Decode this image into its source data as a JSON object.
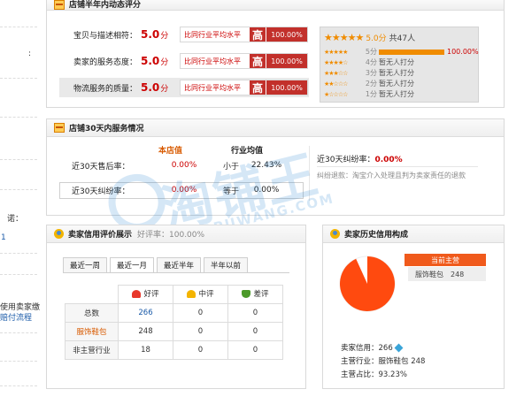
{
  "left_strip": {
    "items": [
      {
        "text": "诺：",
        "color": "#333"
      },
      {
        "text": "使用卖家缴",
        "color": "#333"
      },
      {
        "text": "赔付流程",
        "color": "#1a5aa8"
      }
    ],
    "small_marks": [
      ":",
      "1"
    ]
  },
  "dynamic_rating": {
    "title": "店铺半年内动态评分",
    "rows": [
      {
        "label": "宝贝与描述相符：",
        "score": "5.0",
        "unit": "分",
        "compare_text": "比同行业平均水平",
        "level": "高",
        "percent": "100.00%"
      },
      {
        "label": "卖家的服务态度：",
        "score": "5.0",
        "unit": "分",
        "compare_text": "比同行业平均水平",
        "level": "高",
        "percent": "100.00%"
      },
      {
        "label": "物流服务的质量：",
        "score": "5.0",
        "unit": "分",
        "compare_text": "比同行业平均水平",
        "level": "高",
        "percent": "100.00%"
      }
    ],
    "star_summary": {
      "score": "5.0分",
      "count": "共47人"
    },
    "star_rows": [
      {
        "stars": 5,
        "label": "5分",
        "fill": 1.0,
        "value": "100.00%"
      },
      {
        "stars": 4,
        "label": "4分",
        "fill": 0,
        "value": "暂无人打分"
      },
      {
        "stars": 3,
        "label": "3分",
        "fill": 0,
        "value": "暂无人打分"
      },
      {
        "stars": 2,
        "label": "2分",
        "fill": 0,
        "value": "暂无人打分"
      },
      {
        "stars": 1,
        "label": "1分",
        "fill": 0,
        "value": "暂无人打分"
      }
    ]
  },
  "service": {
    "title": "店铺30天内服务情况",
    "col_shop": "本店值",
    "col_industry": "行业均值",
    "rows": [
      {
        "label": "近30天售后率：",
        "shop": "0.00%",
        "cmp": "小于",
        "industry": "22.43%"
      },
      {
        "label": "近30天纠纷率：",
        "shop": "0.00%",
        "cmp": "等于",
        "industry": "0.00%"
      }
    ],
    "dispute_label": "近30天纠纷率：",
    "dispute_value": "0.00%",
    "dispute_note": "纠纷退款：淘宝介入处理且判为卖家责任的退款"
  },
  "watermark": {
    "big": "淘铺王",
    "small": "TAOPUWANG.COM"
  },
  "credit_rating": {
    "title": "卖家信用评价展示",
    "subtitle": "好评率：100.00%",
    "tabs": [
      "最近一周",
      "最近一月",
      "最近半年",
      "半年以前"
    ],
    "active_tab": 1,
    "headers": [
      "好评",
      "中评",
      "差评"
    ],
    "rows": [
      {
        "label": "总数",
        "good": "266",
        "mid": "0",
        "bad": "0"
      },
      {
        "label": "服饰鞋包",
        "good": "248",
        "mid": "0",
        "bad": "0"
      },
      {
        "label": "非主营行业",
        "good": "18",
        "mid": "0",
        "bad": "0"
      }
    ]
  },
  "history": {
    "title": "卖家历史信用构成",
    "current_tag": "当前主营",
    "category": "服饰鞋包",
    "category_count": "248",
    "pie_color": "#ff4a0f",
    "pie_share": 0.9323,
    "credit_label": "卖家信用：",
    "credit_value": "266",
    "main_label": "主营行业：",
    "main_value": "服饰鞋包 248",
    "ratio_label": "主营占比：",
    "ratio_value": "93.23%"
  }
}
